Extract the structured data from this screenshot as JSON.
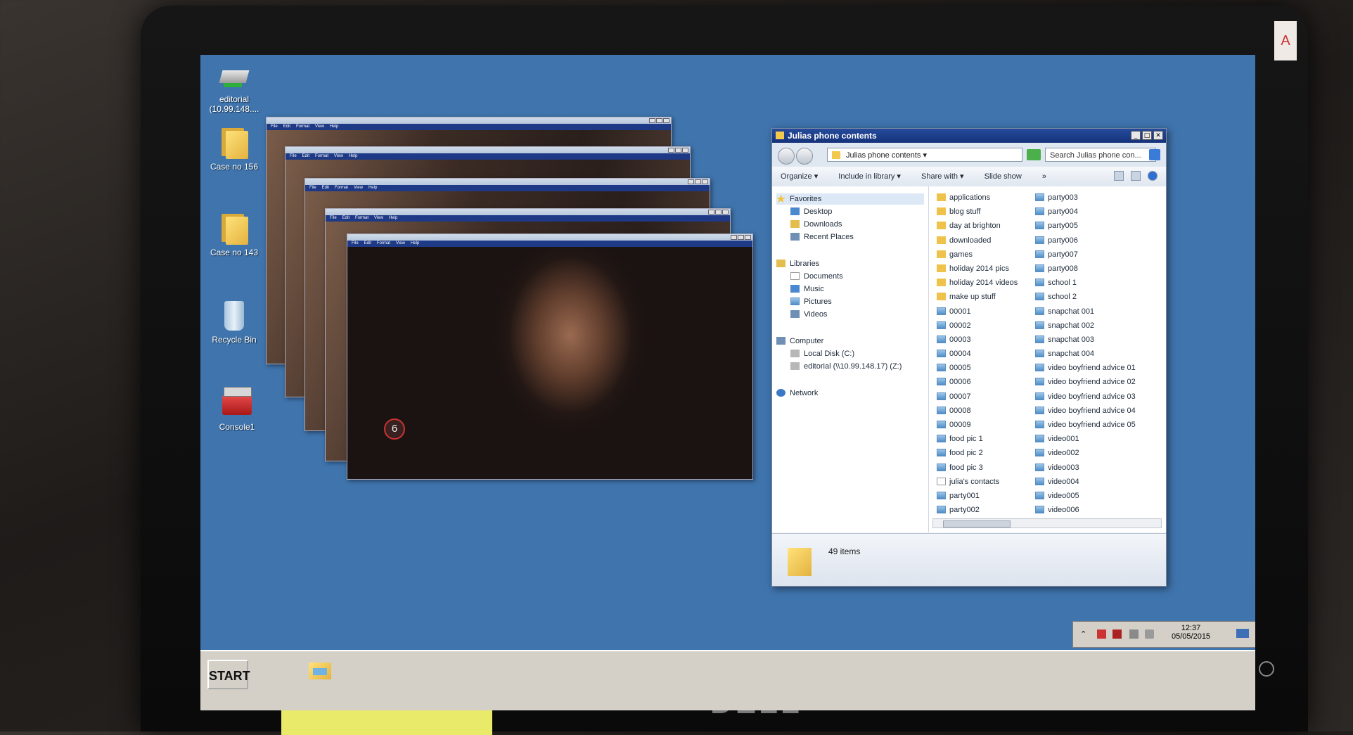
{
  "desktop": {
    "icons": [
      {
        "name": "network-drive-icon",
        "label": "editorial\n(10.99.148...."
      },
      {
        "name": "folder-icon",
        "label": "Case no 156"
      },
      {
        "name": "folder-icon",
        "label": "Case no 143"
      },
      {
        "name": "recycle-bin-icon",
        "label": "Recycle Bin"
      },
      {
        "name": "toolbox-icon",
        "label": "Console1"
      }
    ]
  },
  "video_windows": {
    "menu": [
      "File",
      "Edit",
      "Format",
      "View",
      "Help"
    ],
    "badge": "6"
  },
  "explorer": {
    "title": "Julias phone contents",
    "path": "Julias phone contents",
    "search_placeholder": "Search Julias phone con...",
    "toolbar": [
      "Organize ▾",
      "Include in library ▾",
      "Share with ▾",
      "Slide show",
      "»"
    ],
    "nav": {
      "favorites": "Favorites",
      "desktop": "Desktop",
      "downloads": "Downloads",
      "recent": "Recent Places",
      "libraries": "Libraries",
      "documents": "Documents",
      "music": "Music",
      "pictures": "Pictures",
      "videos": "Videos",
      "computer": "Computer",
      "local_disk": "Local Disk (C:)",
      "editorial": "editorial (\\\\10.99.148.17) (Z:)",
      "network": "Network"
    },
    "files_col1": [
      {
        "name": "applications",
        "type": "folder"
      },
      {
        "name": "blog stuff",
        "type": "folder"
      },
      {
        "name": "day at brighton",
        "type": "folder"
      },
      {
        "name": "downloaded",
        "type": "folder"
      },
      {
        "name": "games",
        "type": "folder"
      },
      {
        "name": "holiday 2014 pics",
        "type": "folder"
      },
      {
        "name": "holiday 2014 videos",
        "type": "folder"
      },
      {
        "name": "make up stuff",
        "type": "folder"
      },
      {
        "name": "00001",
        "type": "image"
      },
      {
        "name": "00002",
        "type": "image"
      },
      {
        "name": "00003",
        "type": "image"
      },
      {
        "name": "00004",
        "type": "image"
      },
      {
        "name": "00005",
        "type": "image"
      },
      {
        "name": "00006",
        "type": "image"
      },
      {
        "name": "00007",
        "type": "image"
      },
      {
        "name": "00008",
        "type": "image"
      },
      {
        "name": "00009",
        "type": "image"
      },
      {
        "name": "food pic 1",
        "type": "image"
      },
      {
        "name": "food pic 2",
        "type": "image"
      },
      {
        "name": "food pic 3",
        "type": "image"
      },
      {
        "name": "julia's contacts",
        "type": "doc"
      },
      {
        "name": "party001",
        "type": "image"
      },
      {
        "name": "party002",
        "type": "image"
      }
    ],
    "files_col2": [
      {
        "name": "party003",
        "type": "image"
      },
      {
        "name": "party004",
        "type": "image"
      },
      {
        "name": "party005",
        "type": "image"
      },
      {
        "name": "party006",
        "type": "image"
      },
      {
        "name": "party007",
        "type": "image"
      },
      {
        "name": "party008",
        "type": "image"
      },
      {
        "name": "school 1",
        "type": "image"
      },
      {
        "name": "school 2",
        "type": "image"
      },
      {
        "name": "snapchat 001",
        "type": "image"
      },
      {
        "name": "snapchat 002",
        "type": "image"
      },
      {
        "name": "snapchat 003",
        "type": "image"
      },
      {
        "name": "snapchat 004",
        "type": "image"
      },
      {
        "name": "video boyfriend advice 01",
        "type": "image"
      },
      {
        "name": "video boyfriend advice 02",
        "type": "image"
      },
      {
        "name": "video boyfriend advice 03",
        "type": "image"
      },
      {
        "name": "video boyfriend advice 04",
        "type": "image"
      },
      {
        "name": "video boyfriend advice 05",
        "type": "image"
      },
      {
        "name": "video001",
        "type": "image"
      },
      {
        "name": "video002",
        "type": "image"
      },
      {
        "name": "video003",
        "type": "image"
      },
      {
        "name": "video004",
        "type": "image"
      },
      {
        "name": "video005",
        "type": "image"
      },
      {
        "name": "video006",
        "type": "image"
      }
    ],
    "item_count": "49 items"
  },
  "taskbar": {
    "start_label": "START",
    "time": "12:37",
    "date": "05/05/2015"
  },
  "monitor": {
    "brand": "DELL",
    "sticker": "A"
  }
}
